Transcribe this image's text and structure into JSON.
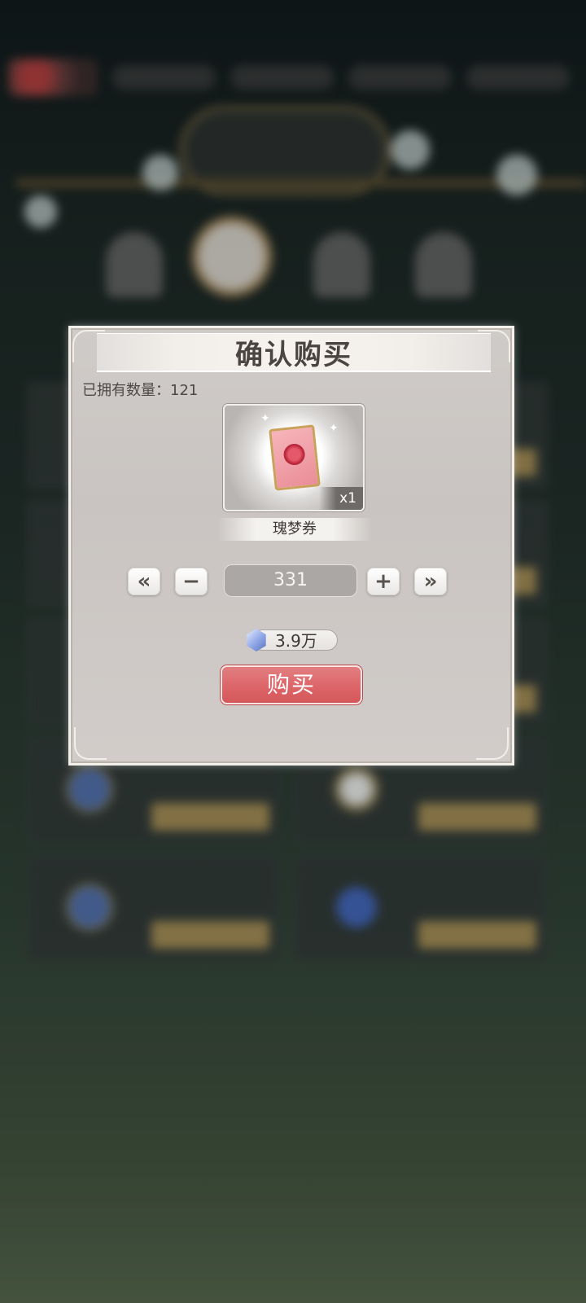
{
  "dialog": {
    "title": "确认购买",
    "owned_label": "已拥有数量：",
    "owned_count": "121",
    "item": {
      "name": "瑰梦券",
      "stack": "x1",
      "icon": "rose-ticket-icon"
    },
    "quantity": "331",
    "controls": {
      "min_icon": "double-chevron-left-icon",
      "minus_icon": "minus-icon",
      "plus_icon": "plus-icon",
      "max_icon": "double-chevron-right-icon"
    },
    "price": {
      "currency_icon": "crystal-gem-icon",
      "amount": "3.9万"
    },
    "buy_label": "购买"
  },
  "colors": {
    "buy_button": "#dc6366",
    "panel": "#cfcbc8",
    "title_text": "#4a4542"
  }
}
